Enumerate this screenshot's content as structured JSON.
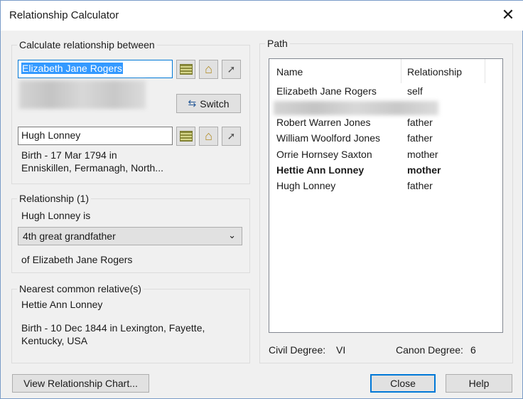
{
  "window": {
    "title": "Relationship Calculator"
  },
  "calc": {
    "legend": "Calculate relationship between",
    "person1": "Elizabeth Jane Rogers",
    "switch_label": "Switch",
    "person2": "Hugh Lonney",
    "person2_birth_line1": "Birth - 17 Mar 1794 in",
    "person2_birth_line2": "Enniskillen, Fermanagh, North..."
  },
  "relationship": {
    "legend": "Relationship (1)",
    "subject": "Hugh Lonney is",
    "selected": "4th great grandfather",
    "object": "of Elizabeth Jane Rogers"
  },
  "nearest": {
    "legend": "Nearest common relative(s)",
    "name": "Hettie Ann Lonney",
    "birth": "Birth - 10 Dec 1844 in Lexington, Fayette, Kentucky, USA"
  },
  "path": {
    "legend": "Path",
    "columns": [
      "Name",
      "Relationship"
    ],
    "rows": [
      {
        "name": "Elizabeth Jane Rogers",
        "rel": "self"
      },
      {
        "name": "",
        "rel": ""
      },
      {
        "name": "Robert Warren Jones",
        "rel": "father"
      },
      {
        "name": "William Woolford Jones",
        "rel": "father"
      },
      {
        "name": "Orrie Hornsey Saxton",
        "rel": "mother"
      },
      {
        "name": "Hettie Ann Lonney",
        "rel": "mother"
      },
      {
        "name": "Hugh Lonney",
        "rel": "father"
      }
    ],
    "civil_label": "Civil Degree:",
    "civil_value": "VI",
    "canon_label": "Canon Degree:",
    "canon_value": "6"
  },
  "buttons": {
    "chart": "View Relationship Chart...",
    "close": "Close",
    "help": "Help"
  }
}
